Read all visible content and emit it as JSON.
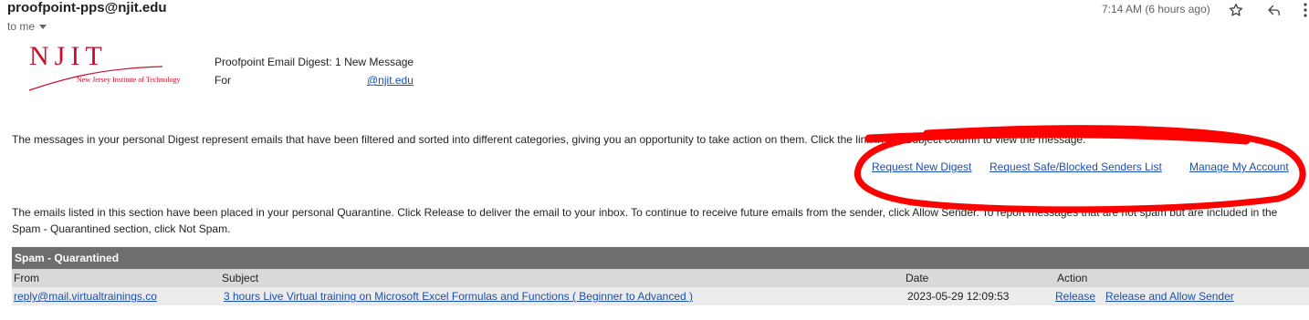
{
  "header": {
    "sender": "proofpoint-pps@njit.edu",
    "to_me": "to me",
    "time": "7:14 AM (6 hours ago)"
  },
  "logo": {
    "name": "NJIT",
    "subtitle": "New Jersey Institute of Technology"
  },
  "digest": {
    "title": "Proofpoint Email Digest: 1 New Message",
    "for_label": "For",
    "email_domain": "@njit.edu"
  },
  "intro_text": "The messages in your personal Digest represent emails that have been filtered and sorted into different categories, giving you an opportunity to take action on them. Click the link in the Subject column to view the message.",
  "links": {
    "request_digest": "Request New Digest",
    "request_safe_blocked": "Request Safe/Blocked Senders List",
    "manage_account": "Manage My Account"
  },
  "quarantine_text": "The emails listed in this section have been placed in your personal Quarantine. Click Release to deliver the email to your inbox. To continue to receive future emails from the sender, click Allow Sender. To report messages that are not spam but are included in the Spam - Quarantined section, click Not Spam.",
  "table": {
    "section_title": "Spam - Quarantined",
    "columns": [
      "From",
      "Subject",
      "Date",
      "Action"
    ],
    "rows": [
      {
        "from": "reply@mail.virtualtrainings.co",
        "subject": "3 hours Live Virtual training on Microsoft Excel Formulas and Functions ( Beginner to Advanced )",
        "date": "2023-05-29 12:09:53",
        "release": "Release",
        "release_allow": "Release and Allow Sender"
      }
    ]
  },
  "colors": {
    "link": "#1a4fb3",
    "njit_red": "#c8102e",
    "annotation_red": "#ff0000",
    "section_header_bg": "#6e6e6e"
  }
}
